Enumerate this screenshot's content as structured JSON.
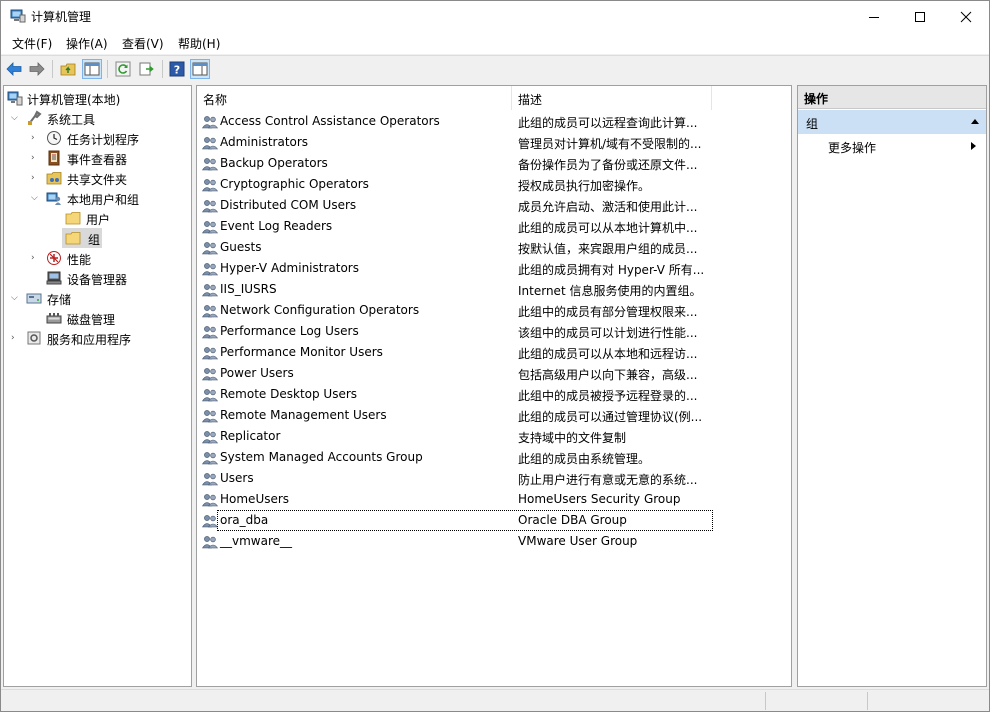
{
  "window": {
    "title": "计算机管理"
  },
  "menu": [
    "文件(F)",
    "操作(A)",
    "查看(V)",
    "帮助(H)"
  ],
  "toolbar": {
    "icons": [
      "back-icon",
      "forward-icon",
      "up-folder-icon",
      "show-hide-console-tree-icon",
      "refresh-icon",
      "export-list-icon",
      "help-icon",
      "show-hide-action-pane-icon"
    ]
  },
  "tree": [
    {
      "label": "计算机管理(本地)",
      "icon": "computer-management-icon",
      "level": 0,
      "expander": ""
    },
    {
      "label": "系统工具",
      "icon": "system-tools-icon",
      "level": 1,
      "expander": "expanded"
    },
    {
      "label": "任务计划程序",
      "icon": "task-scheduler-icon",
      "level": 2,
      "expander": "collapsed"
    },
    {
      "label": "事件查看器",
      "icon": "event-viewer-icon",
      "level": 2,
      "expander": "collapsed"
    },
    {
      "label": "共享文件夹",
      "icon": "shared-folder-icon",
      "level": 2,
      "expander": "collapsed"
    },
    {
      "label": "本地用户和组",
      "icon": "local-users-groups-icon",
      "level": 2,
      "expander": "expanded"
    },
    {
      "label": "用户",
      "icon": "folder-icon",
      "level": 3,
      "expander": ""
    },
    {
      "label": "组",
      "icon": "folder-icon",
      "level": 3,
      "expander": "",
      "selected": true
    },
    {
      "label": "性能",
      "icon": "performance-icon",
      "level": 2,
      "expander": "collapsed"
    },
    {
      "label": "设备管理器",
      "icon": "device-manager-icon",
      "level": 2,
      "expander": ""
    },
    {
      "label": "存储",
      "icon": "storage-icon",
      "level": 1,
      "expander": "expanded"
    },
    {
      "label": "磁盘管理",
      "icon": "disk-management-icon",
      "level": 2,
      "expander": ""
    },
    {
      "label": "服务和应用程序",
      "icon": "services-apps-icon",
      "level": 1,
      "expander": "collapsed"
    }
  ],
  "list": {
    "columns": [
      "名称",
      "描述"
    ],
    "rows": [
      {
        "name": "Access Control Assistance Operators",
        "desc": "此组的成员可以远程查询此计算..."
      },
      {
        "name": "Administrators",
        "desc": "管理员对计算机/域有不受限制的..."
      },
      {
        "name": "Backup Operators",
        "desc": "备份操作员为了备份或还原文件..."
      },
      {
        "name": "Cryptographic Operators",
        "desc": "授权成员执行加密操作。"
      },
      {
        "name": "Distributed COM Users",
        "desc": "成员允许启动、激活和使用此计..."
      },
      {
        "name": "Event Log Readers",
        "desc": "此组的成员可以从本地计算机中..."
      },
      {
        "name": "Guests",
        "desc": "按默认值，来宾跟用户组的成员..."
      },
      {
        "name": "Hyper-V Administrators",
        "desc": "此组的成员拥有对 Hyper-V 所有..."
      },
      {
        "name": "IIS_IUSRS",
        "desc": "Internet 信息服务使用的内置组。"
      },
      {
        "name": "Network Configuration Operators",
        "desc": "此组中的成员有部分管理权限来..."
      },
      {
        "name": "Performance Log Users",
        "desc": "该组中的成员可以计划进行性能..."
      },
      {
        "name": "Performance Monitor Users",
        "desc": "此组的成员可以从本地和远程访..."
      },
      {
        "name": "Power Users",
        "desc": "包括高级用户以向下兼容，高级..."
      },
      {
        "name": "Remote Desktop Users",
        "desc": "此组中的成员被授予远程登录的..."
      },
      {
        "name": "Remote Management Users",
        "desc": "此组的成员可以通过管理协议(例..."
      },
      {
        "name": "Replicator",
        "desc": "支持域中的文件复制"
      },
      {
        "name": "System Managed Accounts Group",
        "desc": "此组的成员由系统管理。"
      },
      {
        "name": "Users",
        "desc": "防止用户进行有意或无意的系统..."
      },
      {
        "name": "HomeUsers",
        "desc": "HomeUsers Security Group"
      },
      {
        "name": "ora_dba",
        "desc": "Oracle DBA Group",
        "focused": true
      },
      {
        "name": "__vmware__",
        "desc": "VMware User Group"
      }
    ]
  },
  "actions": {
    "header": "操作",
    "section": "组",
    "items": [
      "更多操作"
    ]
  }
}
